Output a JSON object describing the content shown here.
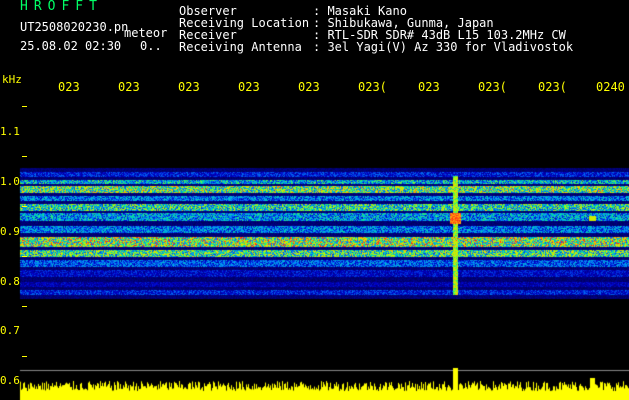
{
  "header": {
    "app_title": "HROFFT",
    "file_name": "UT2508020230.pn",
    "file_kind": "meteor",
    "date_time": "25.08.02 02:30",
    "trailing": "0..",
    "fields": [
      {
        "label": "Observer",
        "value": ": Masaki Kano"
      },
      {
        "label": "Receiving Location",
        "value": ": Shibukawa, Gunma, Japan"
      },
      {
        "label": "Receiver",
        "value": ": RTL-SDR SDR# 43dB L15 103.2MHz CW"
      },
      {
        "label": "Receiving Antenna",
        "value": ": 3el Yagi(V) Az 330 for Vladivostok"
      }
    ]
  },
  "axis": {
    "freq_unit": "kHz",
    "freq_ticks": [
      "1.1",
      "1.0",
      "0.9",
      "0.8",
      "0.7",
      "0.6"
    ],
    "time_ticks": [
      "023",
      "023",
      "023",
      "023",
      "023",
      "023(",
      "023",
      "023(",
      "023(",
      "0240"
    ]
  },
  "colors": {
    "background": "#000000",
    "text": "#ffffff",
    "axis": "#ffff00",
    "title": "#00ff66",
    "noise_floor": "#000066",
    "signal_hot": "#ff2222"
  }
}
